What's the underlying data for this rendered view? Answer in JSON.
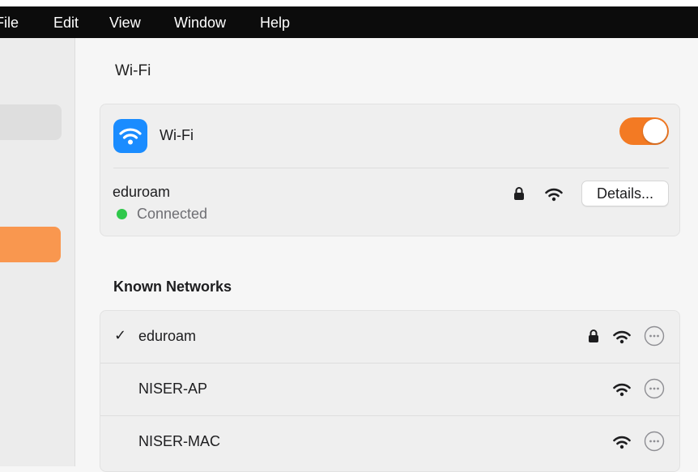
{
  "menubar": {
    "items": [
      "File",
      "Edit",
      "View",
      "Window",
      "Help"
    ]
  },
  "content": {
    "title": "Wi-Fi",
    "wifi_card": {
      "label": "Wi-Fi",
      "toggle_on": true,
      "toggle_color": "#f37a23",
      "icon": "wifi-icon"
    },
    "current_network": {
      "name": "eduroam",
      "status": "Connected",
      "status_color": "#2fc84b",
      "secured": true,
      "details_label": "Details..."
    },
    "known_heading": "Known Networks",
    "known_networks": [
      {
        "name": "eduroam",
        "connected": true,
        "check": "✓",
        "secured": true
      },
      {
        "name": "NISER-AP",
        "connected": false,
        "secured": false
      },
      {
        "name": "NISER-MAC",
        "connected": false,
        "secured": false
      }
    ]
  }
}
